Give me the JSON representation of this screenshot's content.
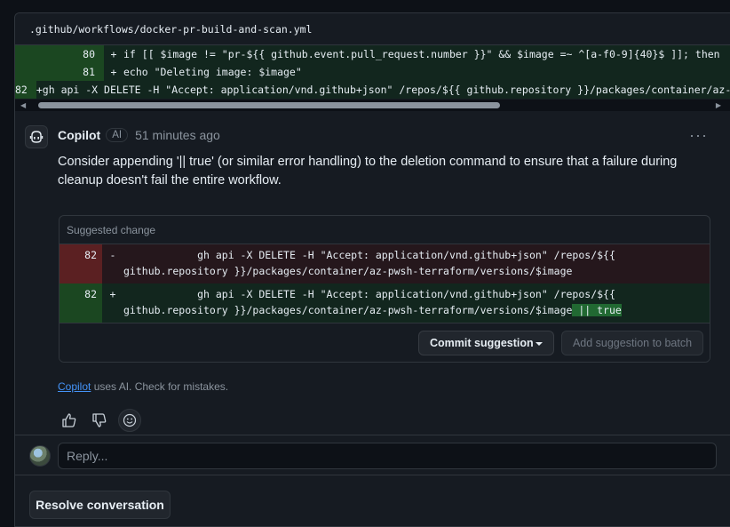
{
  "file": {
    "path": ".github/workflows/docker-pr-build-and-scan.yml"
  },
  "diff_lines": [
    {
      "num": "80",
      "sign": "+",
      "code": "          if [[ $image != \"pr-${{ github.event.pull_request.number }}\" && $image =~ ^[a-f0-9]{40}$ ]]; then"
    },
    {
      "num": "81",
      "sign": "+",
      "code": "            echo \"Deleting image: $image\""
    },
    {
      "num": "82",
      "sign": "+",
      "code": "            gh api -X DELETE -H \"Accept: application/vnd.github+json\" /repos/${{ github.repository }}/packages/container/az-pwsh-terraform/versions/$image"
    }
  ],
  "comment": {
    "author": "Copilot",
    "badge": "AI",
    "time": "51 minutes ago",
    "menu": "···",
    "body": "Consider appending '|| true' (or similar error handling) to the deletion command to ensure that a failure during cleanup doesn't fail the entire workflow."
  },
  "suggestion": {
    "header": "Suggested change",
    "removed": {
      "num": "82",
      "sign": "-",
      "code": "            gh api -X DELETE -H \"Accept: application/vnd.github+json\" /repos/${{ github.repository }}/packages/container/az-pwsh-terraform/versions/$image"
    },
    "added": {
      "num": "82",
      "sign": "+",
      "code": "            gh api -X DELETE -H \"Accept: application/vnd.github+json\" /repos/${{ github.repository }}/packages/container/az-pwsh-terraform/versions/$image",
      "highlight": " || true"
    },
    "commit_label": "Commit suggestion",
    "batch_label": "Add suggestion to batch"
  },
  "disclaimer": {
    "link": "Copilot",
    "text": " uses AI. Check for mistakes."
  },
  "reply": {
    "placeholder": "Reply..."
  },
  "resolve_label": "Resolve conversation",
  "colors": {
    "accent_link": "#4493f8",
    "added_bg": "#12261e",
    "removed_bg": "#25171c"
  }
}
